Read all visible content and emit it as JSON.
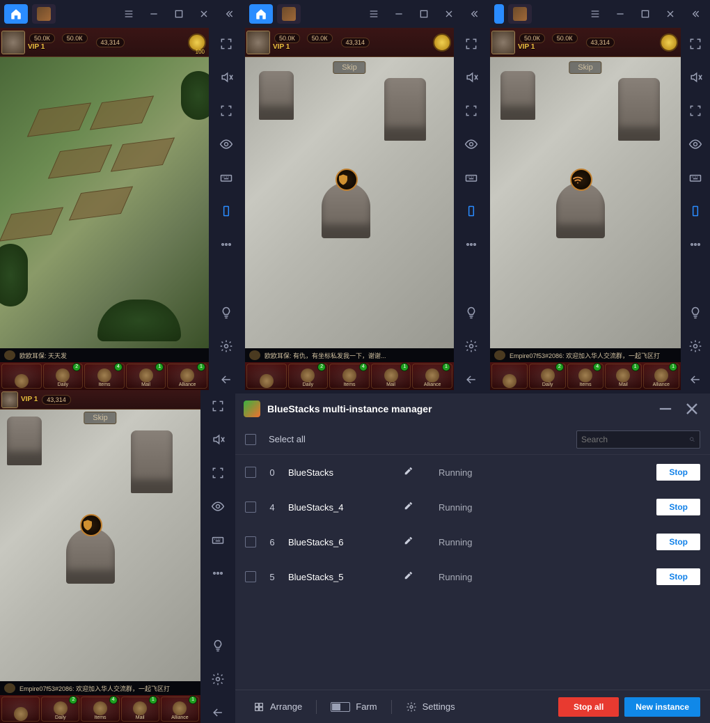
{
  "hud": {
    "vip": "VIP 1",
    "res1": "50.0К",
    "res2": "50.0К",
    "cash": "43,314",
    "coins": "100",
    "skip": "Skip"
  },
  "bottom_slots": [
    {
      "label": "Daily",
      "badge": "2"
    },
    {
      "label": "Items",
      "badge": "4"
    },
    {
      "label": "Mail",
      "badge": "1"
    },
    {
      "label": "Alliance",
      "badge": "1"
    }
  ],
  "chat": {
    "e1": "欧欧耳保: 天天发",
    "e2": "欧欧耳保: 有仇，有坐标私发我一下，谢谢...",
    "e3": "Empire07f53#2086: 欢迎加入华人交流群，一起飞区打",
    "e4": "Empire07f53#2086: 欢迎加入华人交流群，一起飞区打"
  },
  "manager": {
    "title": "BlueStacks multi-instance manager",
    "select_all": "Select all",
    "search_placeholder": "Search",
    "rows": [
      {
        "idx": "0",
        "name": "BlueStacks",
        "status": "Running",
        "action": "Stop"
      },
      {
        "idx": "4",
        "name": "BlueStacks_4",
        "status": "Running",
        "action": "Stop"
      },
      {
        "idx": "6",
        "name": "BlueStacks_6",
        "status": "Running",
        "action": "Stop"
      },
      {
        "idx": "5",
        "name": "BlueStacks_5",
        "status": "Running",
        "action": "Stop"
      }
    ],
    "footer": {
      "arrange": "Arrange",
      "farm": "Farm",
      "settings": "Settings",
      "stop_all": "Stop all",
      "new_instance": "New instance"
    }
  }
}
